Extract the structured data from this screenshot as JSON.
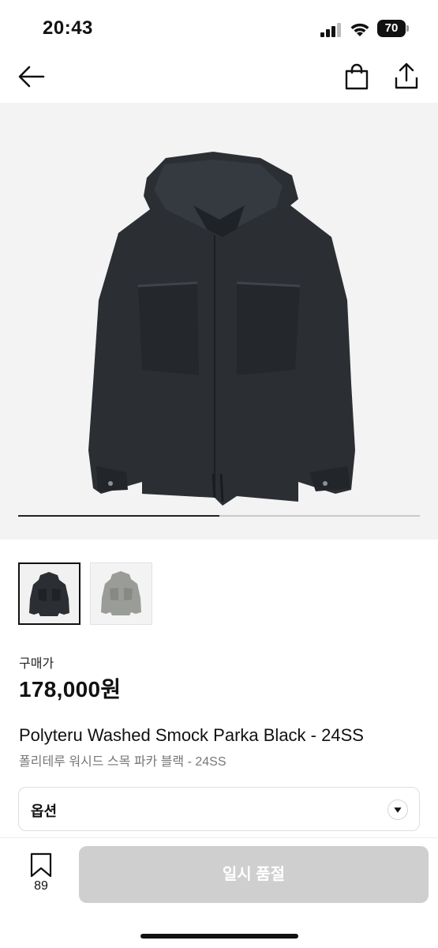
{
  "status": {
    "time": "20:43",
    "battery": "70"
  },
  "nav": {
    "back_icon": "arrow-left-icon",
    "cart_icon": "shopping-bag-icon",
    "share_icon": "share-icon"
  },
  "gallery": {
    "progress_fraction": 0.5,
    "thumbnails": [
      "black parka",
      "grey parka"
    ]
  },
  "product": {
    "price_label": "구매가",
    "price": "178,000원",
    "title_en": "Polyteru Washed Smock Parka Black - 24SS",
    "title_ko": "폴리테루 워시드 스목 파카 블랙 - 24SS"
  },
  "option": {
    "label": "옵션",
    "icon": "chevron-down-icon"
  },
  "bottom": {
    "wish_count": "89",
    "soldout_label": "일시 품절"
  },
  "colors": {
    "accent": "#111111",
    "disabled_button": "#cfcfcf",
    "image_bg": "#f3f3f3"
  }
}
